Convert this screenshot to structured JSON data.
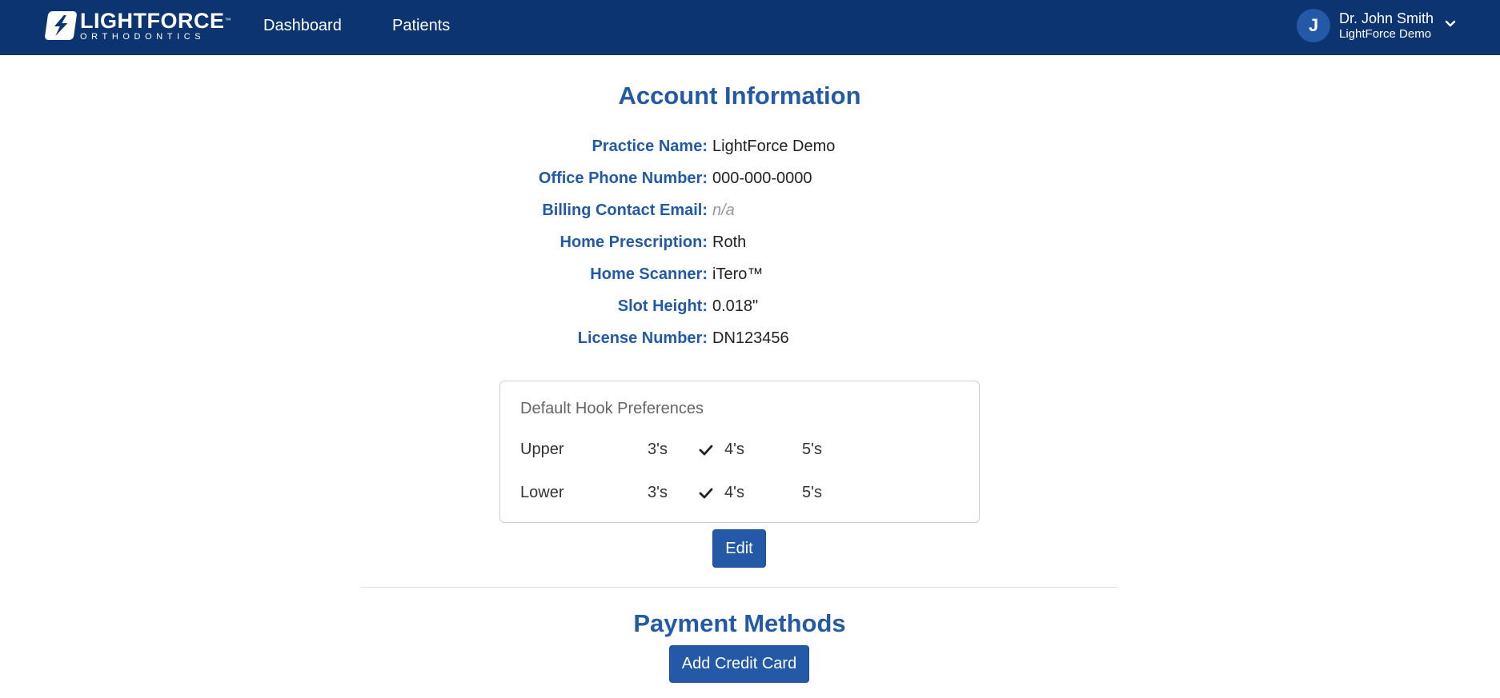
{
  "brand": {
    "name": "LIGHTFORCE",
    "tm": "™",
    "sub": "ORTHODONTICS"
  },
  "nav": {
    "items": [
      {
        "label": "Dashboard"
      },
      {
        "label": "Patients"
      }
    ]
  },
  "user": {
    "initial": "J",
    "name": "Dr. John Smith",
    "org": "LightForce Demo"
  },
  "account": {
    "title": "Account Information",
    "fields": [
      {
        "label": "Practice Name:",
        "value": "LightForce Demo"
      },
      {
        "label": "Office Phone Number:",
        "value": "000-000-0000"
      },
      {
        "label": "Billing Contact Email:",
        "value": "n/a"
      },
      {
        "label": "Home Prescription:",
        "value": "Roth"
      },
      {
        "label": "Home Scanner:",
        "value": "iTero™"
      },
      {
        "label": "Slot Height:",
        "value": "0.018\""
      },
      {
        "label": "License Number:",
        "value": "DN123456"
      }
    ]
  },
  "hooks": {
    "title": "Default Hook Preferences",
    "rows": [
      {
        "jaw": "Upper",
        "options": [
          "3's",
          "4's",
          "5's"
        ],
        "selected": "4's"
      },
      {
        "jaw": "Lower",
        "options": [
          "3's",
          "4's",
          "5's"
        ],
        "selected": "4's"
      }
    ]
  },
  "edit_label": "Edit",
  "payment": {
    "title": "Payment Methods",
    "add_label": "Add Credit Card"
  },
  "colors": {
    "navbar": "#0c3470",
    "accent": "#2359a6"
  }
}
